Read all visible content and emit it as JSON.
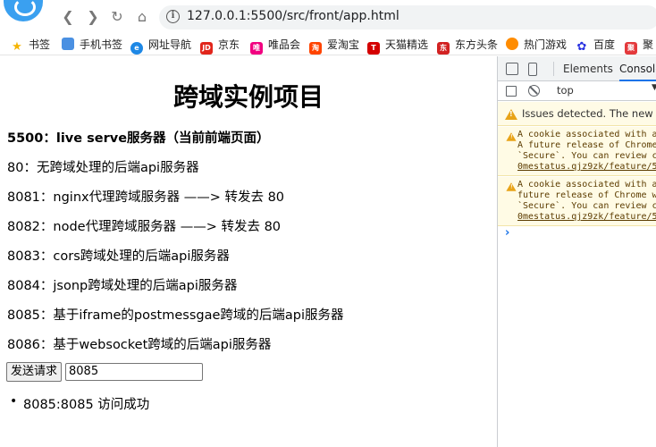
{
  "browser": {
    "url": "127.0.0.1:5500/src/front/app.html",
    "bookmarks": [
      {
        "label": "书签",
        "icon": "star-icon",
        "color": "#f5b400"
      },
      {
        "label": "手机书签",
        "icon": "phone-icon",
        "color": "#4a90e2"
      },
      {
        "label": "网址导航",
        "icon": "e-icon",
        "color": "#1e88e5"
      },
      {
        "label": "京东",
        "icon": "jd-icon",
        "color": "#e1251b"
      },
      {
        "label": "唯品会",
        "icon": "vip-icon",
        "color": "#f10180"
      },
      {
        "label": "爱淘宝",
        "icon": "taobao-icon",
        "color": "#ff4400"
      },
      {
        "label": "天猫精选",
        "icon": "tmall-icon",
        "color": "#d40000"
      },
      {
        "label": "东方头条",
        "icon": "dftt-icon",
        "color": "#d22222"
      },
      {
        "label": "热门游戏",
        "icon": "game-icon",
        "color": "#ff8c00"
      },
      {
        "label": "百度",
        "icon": "baidu-icon",
        "color": "#2932e1"
      },
      {
        "label": "聚",
        "icon": "ju-icon",
        "color": "#e4393c"
      }
    ]
  },
  "page": {
    "title": "跨域实例项目",
    "lines": [
      "5500：live serve服务器（当前前端页面）",
      "80：无跨域处理的后端api服务器",
      "8081：nginx代理跨域服务器 ——> 转发去 80",
      "8082：node代理跨域服务器 ——> 转发去 80",
      "8083：cors跨域处理的后端api服务器",
      "8084：jsonp跨域处理的后端api服务器",
      "8085：基于iframe的postmessgae跨域的后端api服务器",
      "8086：基于websocket跨域的后端api服务器"
    ],
    "send_button": "发送请求",
    "port_input_value": "8085",
    "results": [
      "8085:8085 访问成功"
    ]
  },
  "devtools": {
    "tabs": [
      "Elements",
      "Console"
    ],
    "active_tab": "Console",
    "context": "top",
    "issues_banner": "Issues detected. The new Issues",
    "warnings": [
      {
        "lines": [
          "A cookie associated with a",
          "A future release of Chrome",
          "`Secure`. You can review c"
        ],
        "link": "0mestatus.qjz9zk/feature/5"
      },
      {
        "lines": [
          "A cookie associated with a",
          "future release of Chrome w",
          "`Secure`. You can review c"
        ],
        "link": "0mestatus.qjz9zk/feature/5"
      }
    ],
    "prompt": "›"
  }
}
